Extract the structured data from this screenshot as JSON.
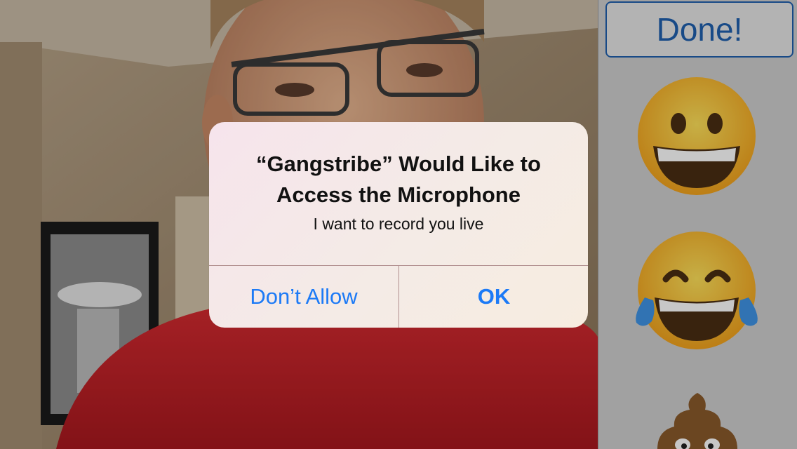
{
  "camera_feed": {
    "description_icon": "camera-preview"
  },
  "panel": {
    "done_label": "Done!",
    "emojis": [
      {
        "name": "grinning-face-icon"
      },
      {
        "name": "tears-of-joy-icon"
      },
      {
        "name": "pile-of-poo-icon"
      }
    ]
  },
  "alert": {
    "title_line1": "“Gangstribe” Would Like to",
    "title_line2": "Access the Microphone",
    "message": "I want to record you live",
    "deny_label": "Don’t Allow",
    "ok_label": "OK"
  },
  "colors": {
    "ios_blue": "#1c7af6",
    "done_blue": "#1f5fae",
    "shirt_red": "#c8232a"
  }
}
